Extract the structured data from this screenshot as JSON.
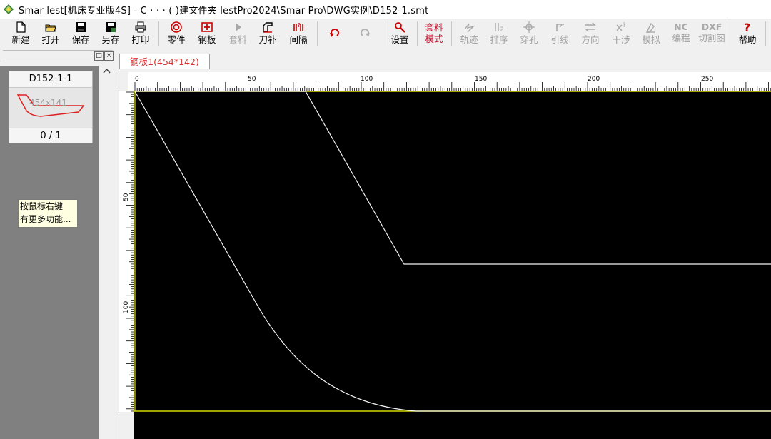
{
  "window": {
    "title": "Smar    lest[机床专业版4S] - C    ·  ·  ·    (    )建文件夹          lestPro2024\\Smar         Pro\\DWG实例\\D152-1.smt",
    "app_icon": "smartnest-logo-icon"
  },
  "toolbar": {
    "buttons": [
      {
        "id": "new",
        "label": "新建",
        "icon": "new-file-icon",
        "enabled": true
      },
      {
        "id": "open",
        "label": "打开",
        "icon": "open-folder-icon",
        "enabled": true
      },
      {
        "id": "save",
        "label": "保存",
        "icon": "floppy-disk-icon",
        "enabled": true
      },
      {
        "id": "saveas",
        "label": "另存",
        "icon": "save-as-icon",
        "enabled": true
      },
      {
        "id": "print",
        "label": "打印",
        "icon": "printer-icon",
        "enabled": true
      },
      {
        "id": "part",
        "label": "零件",
        "icon": "part-icon",
        "enabled": true
      },
      {
        "id": "plate",
        "label": "钢板",
        "icon": "plate-icon",
        "enabled": true
      },
      {
        "id": "nest",
        "label": "套料",
        "icon": "play-icon",
        "enabled": false
      },
      {
        "id": "kerf",
        "label": "刀补",
        "icon": "kerf-icon",
        "enabled": true
      },
      {
        "id": "spacing",
        "label": "间隔",
        "icon": "spacing-icon",
        "enabled": true
      },
      {
        "id": "undo",
        "label": "",
        "icon": "undo-icon",
        "enabled": true
      },
      {
        "id": "redo",
        "label": "",
        "icon": "redo-icon",
        "enabled": false
      },
      {
        "id": "settings",
        "label": "设置",
        "icon": "settings-wrench-icon",
        "enabled": true
      },
      {
        "id": "nestmode",
        "label": "套料\n模式",
        "icon": "",
        "enabled": true
      },
      {
        "id": "path",
        "label": "轨迹",
        "icon": "path-icon",
        "enabled": false
      },
      {
        "id": "sort",
        "label": "排序",
        "icon": "sort-icon",
        "enabled": false
      },
      {
        "id": "pierce",
        "label": "穿孔",
        "icon": "pierce-icon",
        "enabled": false
      },
      {
        "id": "leadin",
        "label": "引线",
        "icon": "lead-in-icon",
        "enabled": false
      },
      {
        "id": "direction",
        "label": "方向",
        "icon": "direction-icon",
        "enabled": false
      },
      {
        "id": "interference",
        "label": "干涉",
        "icon": "interference-icon",
        "enabled": false
      },
      {
        "id": "simulate",
        "label": "模拟",
        "icon": "simulate-icon",
        "enabled": false
      },
      {
        "id": "nc",
        "label": "编程",
        "top": "NC",
        "icon": "",
        "enabled": false
      },
      {
        "id": "dxf",
        "label": "切割图",
        "top": "DXF",
        "icon": "",
        "enabled": false
      },
      {
        "id": "help",
        "label": "帮助",
        "icon": "help-question-icon",
        "enabled": true
      }
    ]
  },
  "left_panel": {
    "header_buttons": [
      "□",
      "×"
    ],
    "thumbnail": {
      "name": "D152-1-1",
      "dims": "454x141",
      "count": "0 / 1"
    },
    "tooltip": {
      "line1": "按鼠标右键",
      "line2": "有更多功能..."
    }
  },
  "tabs": [
    {
      "label": "钢板1(454*142)",
      "active": true
    }
  ],
  "canvas": {
    "ruler_x_labels": [
      "0",
      "50",
      "100",
      "150",
      "200",
      "250"
    ],
    "ruler_y_labels": [
      "50",
      "100"
    ],
    "colors": {
      "background": "#000000",
      "part_outline": "#f2f2f2",
      "plate_border": "#d8d800"
    }
  }
}
